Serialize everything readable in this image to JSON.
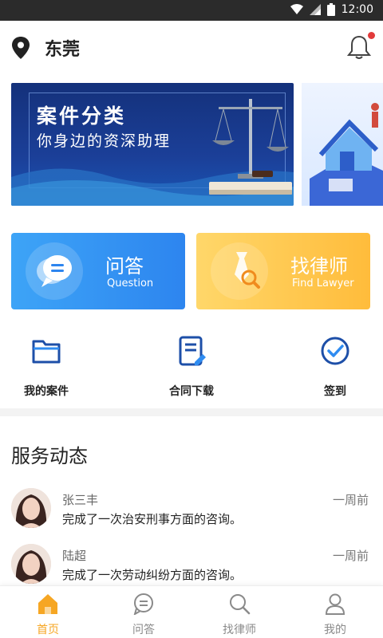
{
  "status_bar": {
    "time": "12:00"
  },
  "header": {
    "city": "东莞"
  },
  "banner": {
    "title": "案件分类",
    "subtitle": "你身边的资深助理"
  },
  "cards": [
    {
      "title": "问答",
      "subtitle": "Question",
      "color": "#2f8cf1"
    },
    {
      "title": "找律师",
      "subtitle": "Find Lawyer",
      "color": "#ffc546"
    }
  ],
  "quick_actions": [
    {
      "label": "我的案件",
      "icon": "folder-icon"
    },
    {
      "label": "合同下载",
      "icon": "document-edit-icon"
    },
    {
      "label": "签到",
      "icon": "check-circle-icon"
    }
  ],
  "section": {
    "title": "服务动态"
  },
  "feed": [
    {
      "name": "张三丰",
      "time": "一周前",
      "desc": "完成了一次治安刑事方面的咨询。"
    },
    {
      "name": "陆超",
      "time": "一周前",
      "desc": "完成了一次劳动纠纷方面的咨询。"
    }
  ],
  "tabbar": {
    "active_color": "#f6a623",
    "tabs": [
      {
        "label": "首页",
        "icon": "home-icon"
      },
      {
        "label": "问答",
        "icon": "chat-icon"
      },
      {
        "label": "找律师",
        "icon": "search-icon"
      },
      {
        "label": "我的",
        "icon": "user-icon"
      }
    ]
  }
}
